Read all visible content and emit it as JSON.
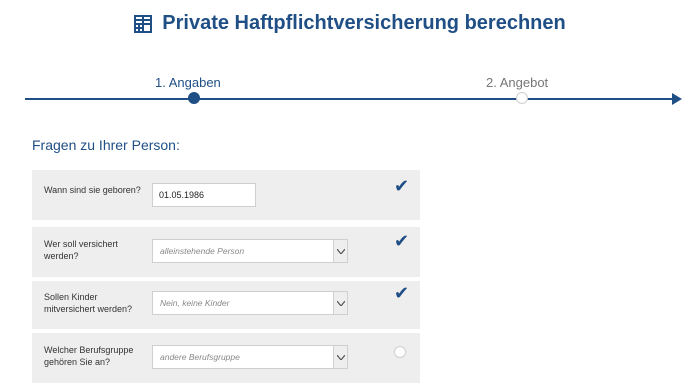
{
  "header": {
    "title": "Private Haftpflichtversicherung berechnen",
    "icon": "calculator-icon"
  },
  "progress": {
    "steps": [
      {
        "label": "1. Angaben",
        "state": "active"
      },
      {
        "label": "2. Angebot",
        "state": "inactive"
      }
    ]
  },
  "section": {
    "heading": "Fragen zu Ihrer Person:"
  },
  "questions": [
    {
      "label": "Wann sind sie geboren?",
      "value": "01.05.1986",
      "status": "checked"
    },
    {
      "label": "Wer soll versichert werden?",
      "value": "alleinstehende Person",
      "status": "checked"
    },
    {
      "label": "Sollen Kinder mitversichert werden?",
      "value": "Nein, keine Kinder",
      "status": "checked"
    },
    {
      "label": "Welcher Berufsgruppe gehören Sie an?",
      "value": "andere Berufsgruppe",
      "status": "pending"
    }
  ],
  "colors": {
    "accent": "#1f4f85",
    "row_bg": "#eeeeee",
    "border": "#cfcfcf"
  },
  "check_symbol": "✔"
}
